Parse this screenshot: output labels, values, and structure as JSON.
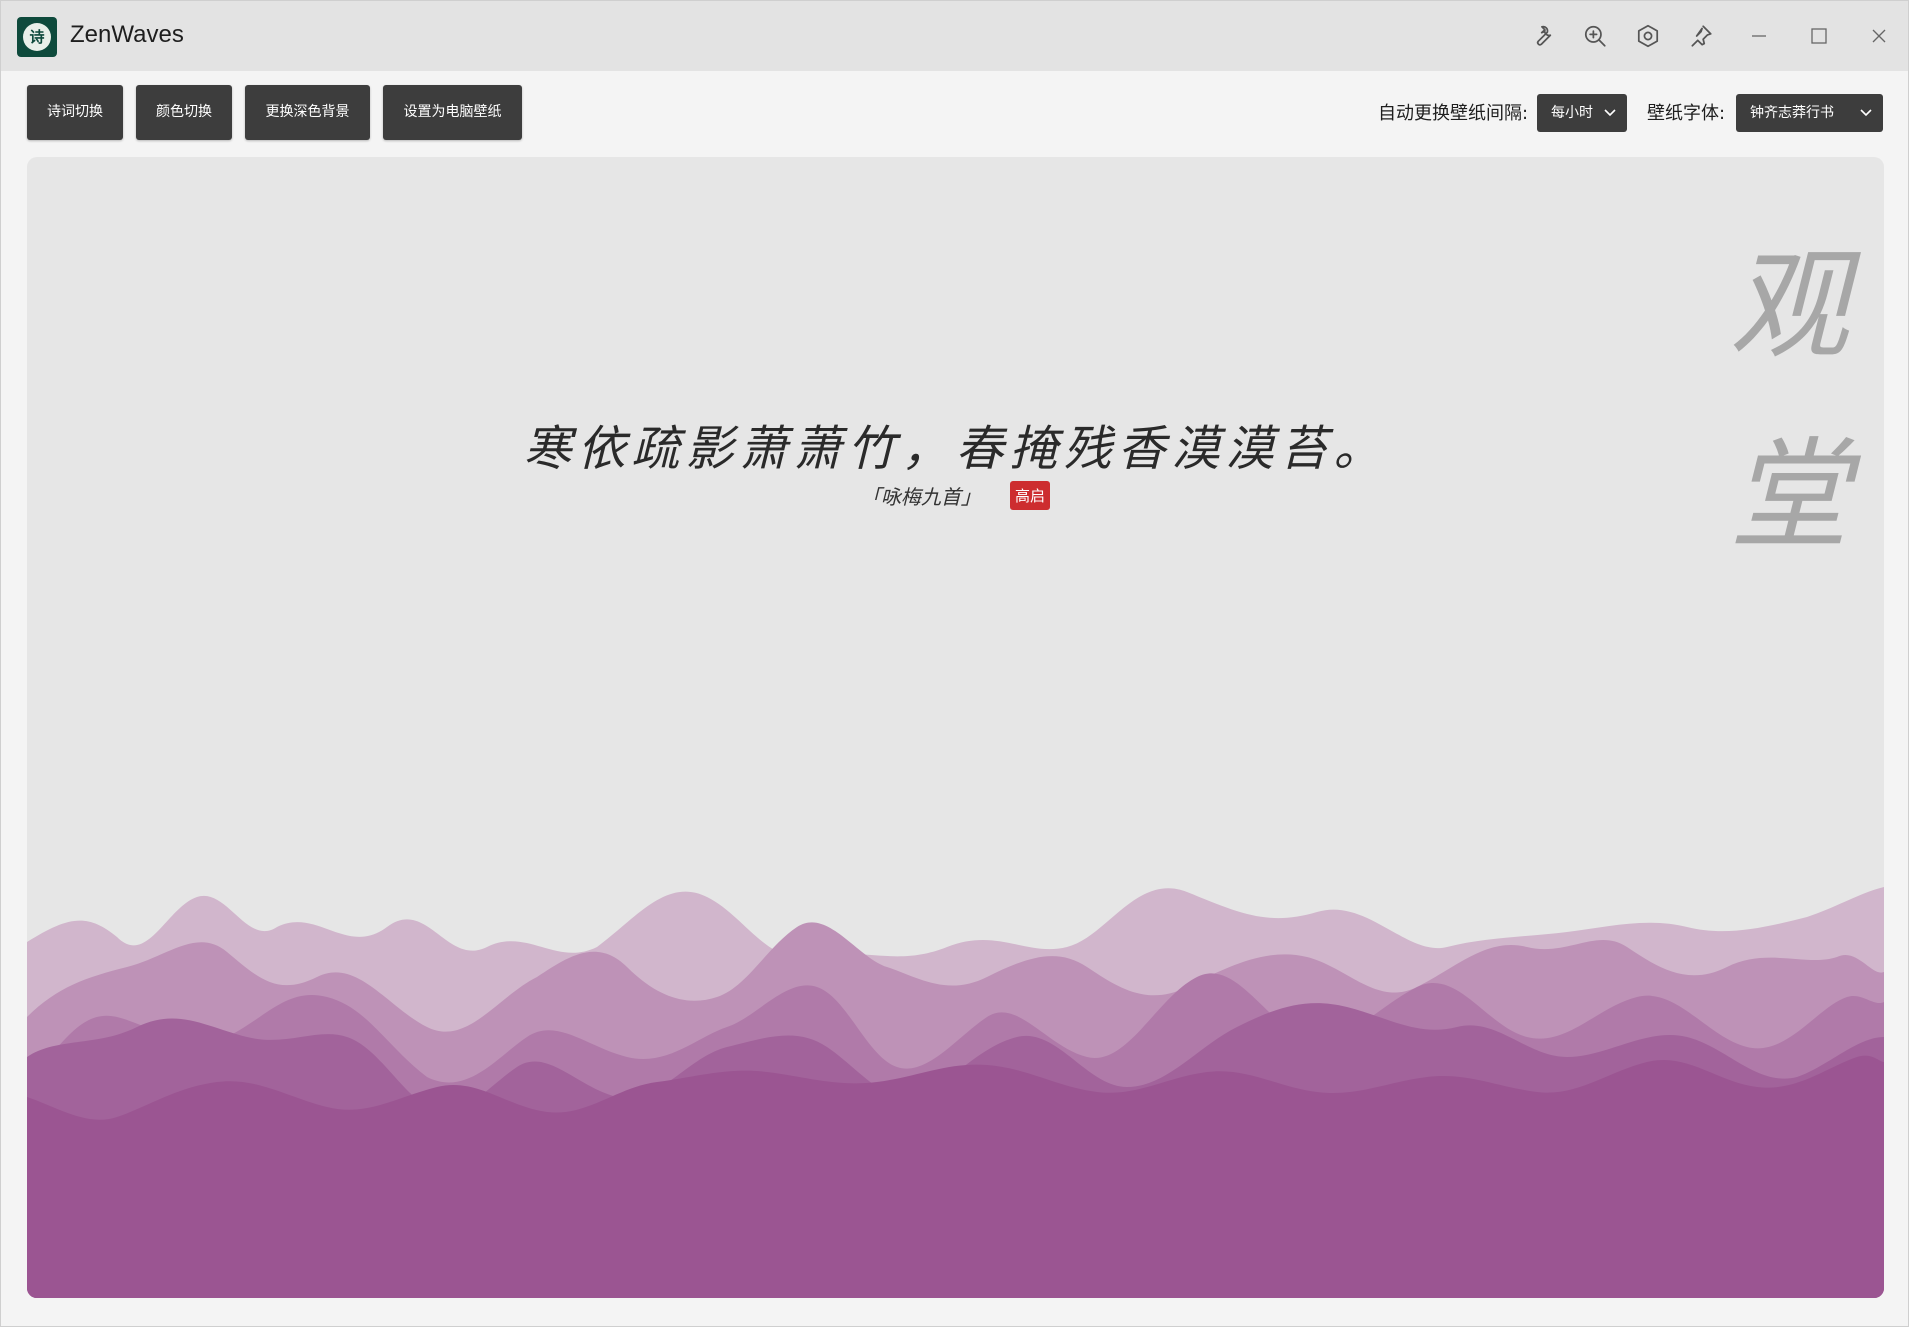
{
  "app": {
    "title": "ZenWaves",
    "icon_glyph": "诗"
  },
  "titlebar_icons": [
    "wrench-icon",
    "zoom-in-icon",
    "settings-icon",
    "pin-icon",
    "minimize-icon",
    "maximize-icon",
    "close-icon"
  ],
  "toolbar": {
    "buttons": [
      {
        "label": "诗词切换"
      },
      {
        "label": "颜色切换"
      },
      {
        "label": "更换深色背景"
      },
      {
        "label": "设置为电脑壁纸"
      }
    ],
    "interval_label": "自动更换壁纸间隔:",
    "interval_value": "每小时",
    "font_label": "壁纸字体:",
    "font_value": "钟齐志莽行书"
  },
  "poem": {
    "line": "寒依疏影萧萧竹，春掩残香漠漠苔。",
    "source": "「咏梅九首」",
    "author": "高启",
    "title_vertical": "观堂"
  },
  "colors": {
    "canvas_bg": "#e6e6e6",
    "wave_1": "#d1b6cc",
    "wave_2": "#be92b7",
    "wave_3": "#b07aa9",
    "wave_4": "#a2639b",
    "wave_5": "#9b5592",
    "button_bg": "#3d3d3d",
    "seal": "#cd2d2f"
  }
}
